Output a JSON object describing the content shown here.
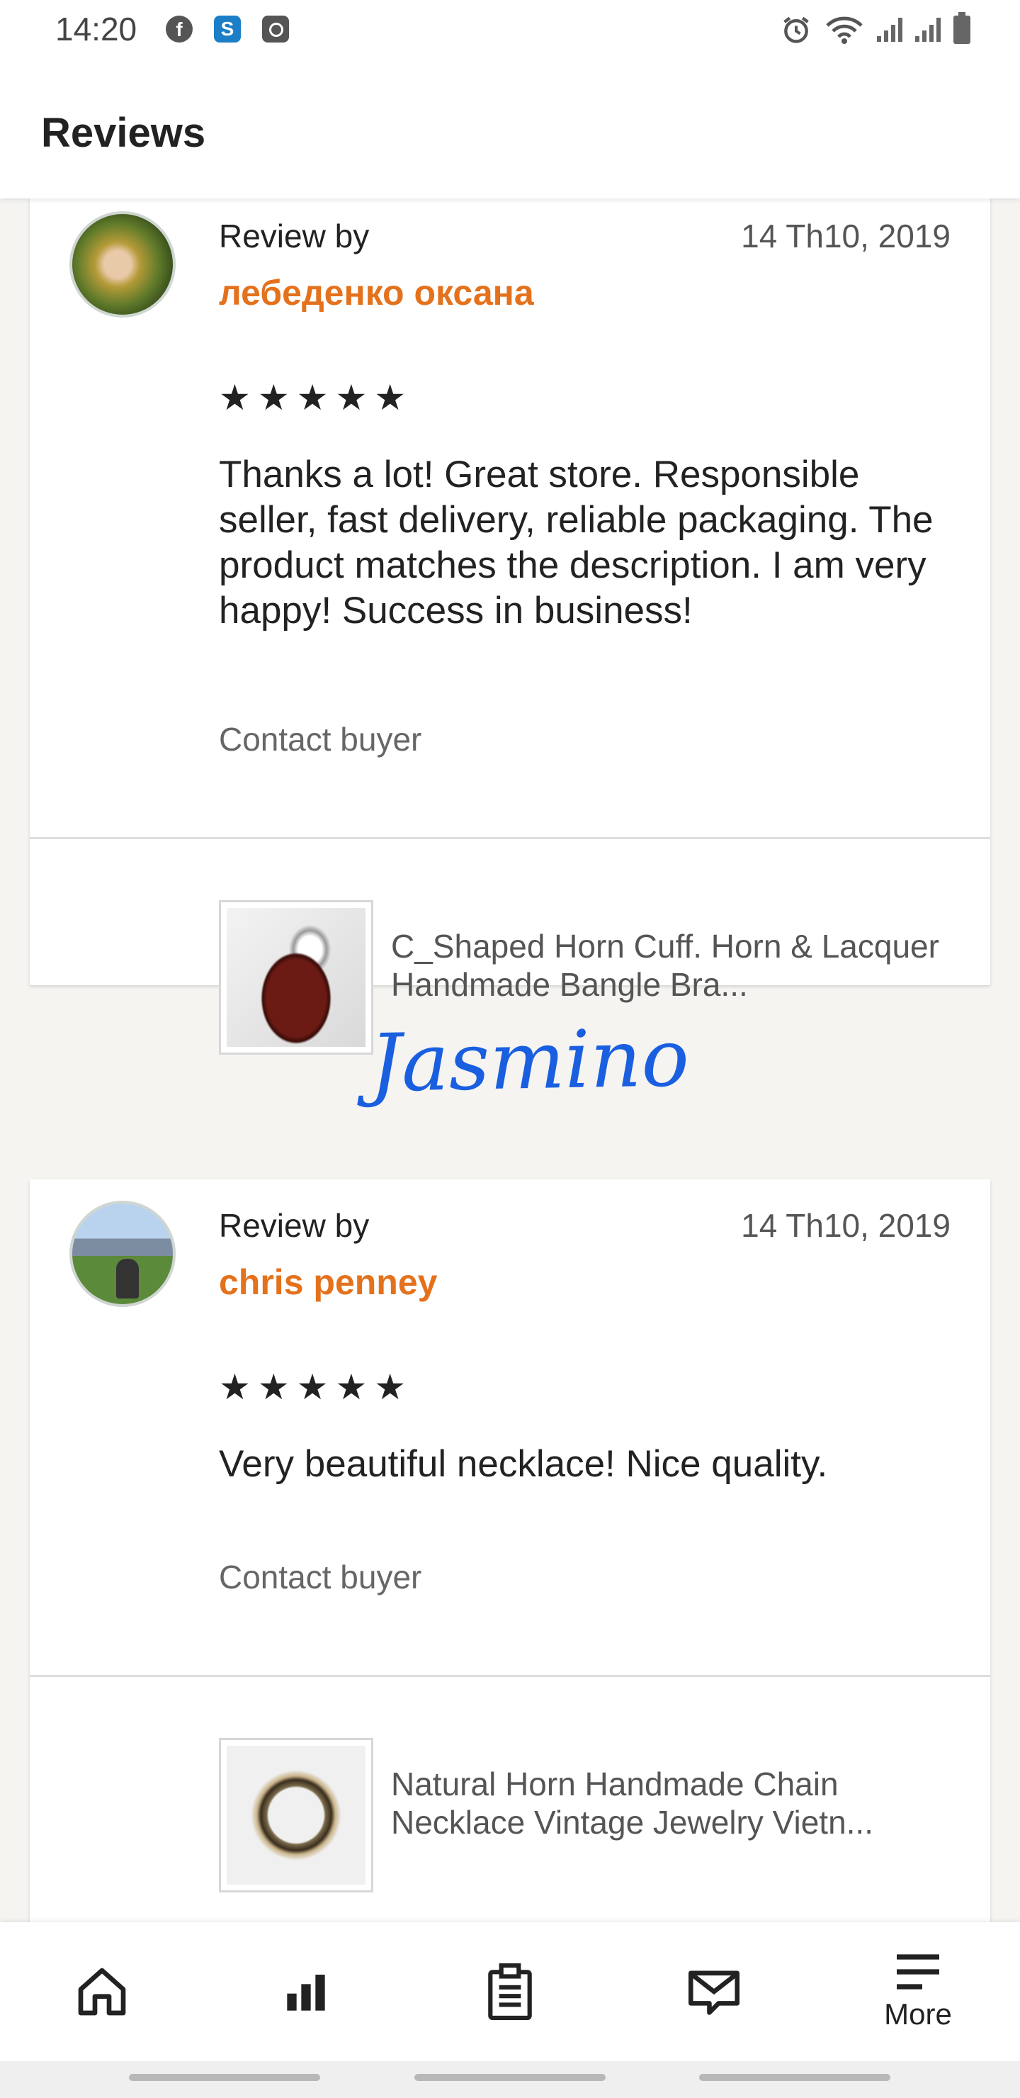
{
  "status_bar": {
    "time": "14:20",
    "apps": [
      "facebook-icon",
      "s-app-icon",
      "clock-app-icon"
    ],
    "s_glyph": "S",
    "fb_glyph": "f",
    "right_icons": [
      "alarm-icon",
      "wifi-icon",
      "signal-icon",
      "signal-icon",
      "battery-icon"
    ]
  },
  "header": {
    "title": "Reviews"
  },
  "reviews": [
    {
      "review_by_label": "Review by",
      "reviewer": "лебеденко оксана",
      "date": "14 Th10, 2019",
      "stars": "★★★★★",
      "rating": 5,
      "text": "Thanks a lot! Great store. Responsible seller, fast delivery, reliable packaging. The product matches the description. I am very happy! Success in business!",
      "contact_label": "Contact buyer",
      "listing_title": "C_Shaped Horn Cuff. Horn & Lacquer Handmade Bangle Bra..."
    },
    {
      "review_by_label": "Review by",
      "reviewer": "chris penney",
      "date": "14 Th10, 2019",
      "stars": "★★★★★",
      "rating": 5,
      "text": "Very beautiful necklace! Nice quality.",
      "contact_label": "Contact buyer",
      "listing_title": "Natural Horn Handmade Chain Necklace Vintage Jewelry Vietn..."
    }
  ],
  "watermark": "Jasmino",
  "bottom_nav": {
    "items": [
      {
        "icon": "home-icon",
        "label": ""
      },
      {
        "icon": "stats-icon",
        "label": ""
      },
      {
        "icon": "orders-icon",
        "label": ""
      },
      {
        "icon": "messages-icon",
        "label": ""
      },
      {
        "icon": "menu-icon",
        "label": "More"
      }
    ]
  },
  "colors": {
    "accent": "#e4711c",
    "watermark": "#1a5fe0",
    "background": "#f5f4f1"
  }
}
